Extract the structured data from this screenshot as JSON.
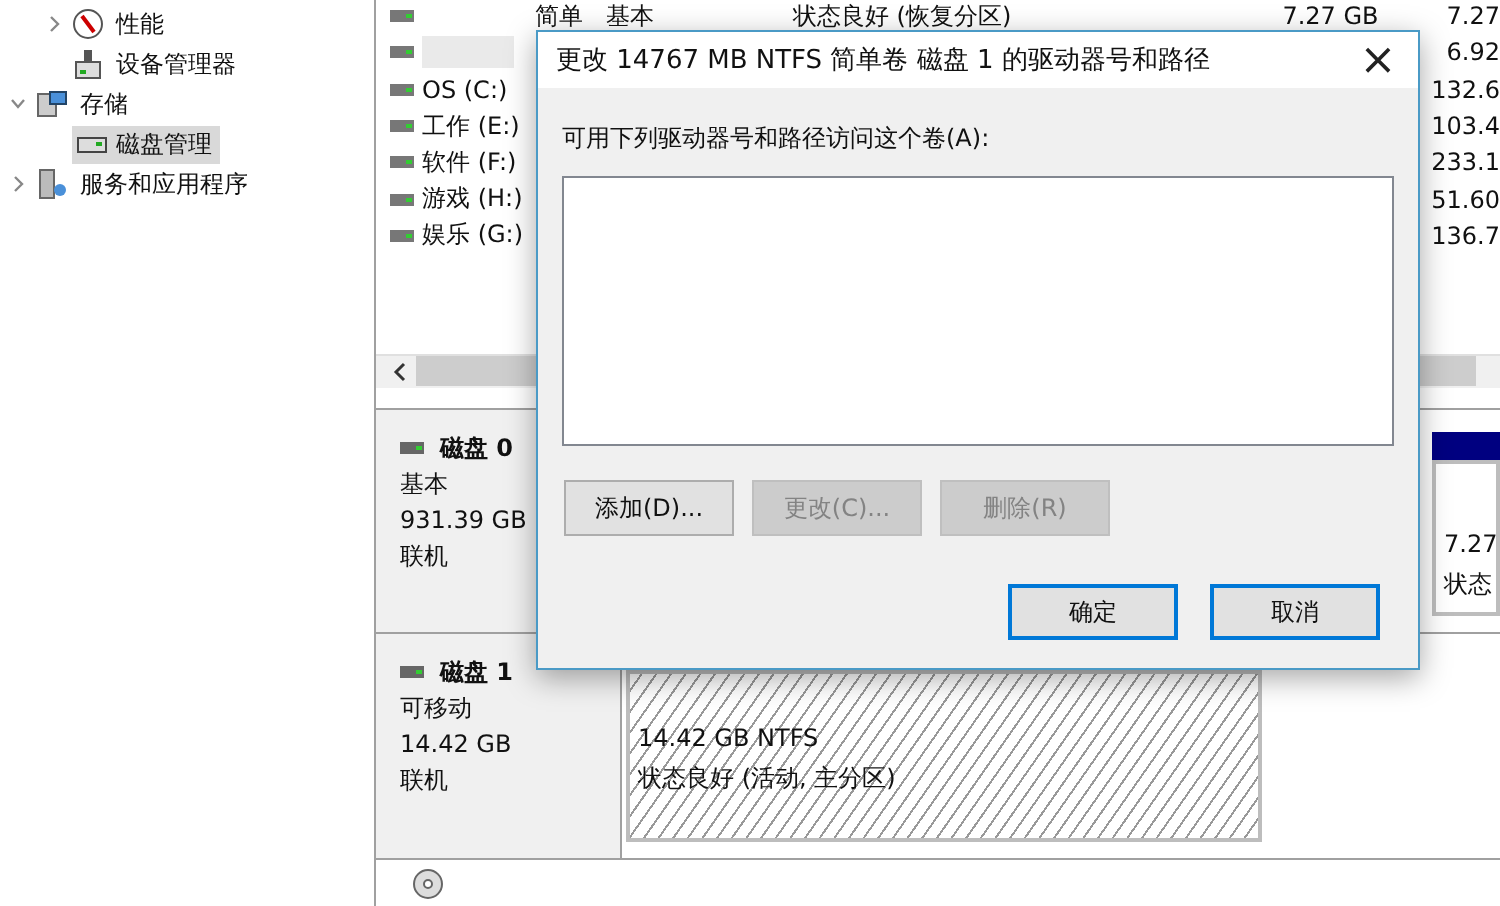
{
  "sidebar": {
    "upper_items": [
      {
        "label": "性能",
        "expanded": false
      },
      {
        "label": "设备管理器"
      }
    ],
    "items": [
      {
        "label": "存储",
        "expanded": true,
        "children": [
          {
            "label": "磁盘管理",
            "selected": true
          }
        ]
      },
      {
        "label": "服务和应用程序",
        "expanded": false
      }
    ]
  },
  "volumes": [
    {
      "layout": "简单",
      "type": "基本",
      "status": "状态良好 (恢复分区)",
      "capacity": "7.27 GB",
      "free": "7.27",
      "selected": false
    },
    {
      "selected": true,
      "free": "6.92"
    },
    {
      "name": "OS (C:)",
      "free": "132.6",
      "selected": false
    },
    {
      "name": "工作 (E:)",
      "free": "103.4",
      "selected": false
    },
    {
      "name": "软件 (F:)",
      "free": "233.1",
      "selected": false
    },
    {
      "name": "游戏 (H:)",
      "free": "51.60",
      "selected": false
    },
    {
      "name": "娱乐 (G:)",
      "free": "136.7",
      "selected": false
    }
  ],
  "disks": [
    {
      "name": "磁盘 0",
      "type": "基本",
      "size": "931.39 GB",
      "state": "联机",
      "partitions": [
        {
          "kind": "edge",
          "size": "7.27",
          "status": "状态"
        }
      ]
    },
    {
      "name": "磁盘 1",
      "type": "可移动",
      "size": "14.42 GB",
      "state": "联机",
      "partitions": [
        {
          "kind": "hatched",
          "size": "14.42 GB NTFS",
          "status": "状态良好 (活动, 主分区)"
        }
      ]
    }
  ],
  "dialog": {
    "title": "更改 14767 MB NTFS 简单卷 磁盘 1 的驱动器号和路径",
    "close": "×",
    "label": "可用下列驱动器号和路径访问这个卷(A):",
    "list_buttons": [
      {
        "label": "添加(D)...",
        "disabled": false
      },
      {
        "label": "更改(C)...",
        "disabled": true
      },
      {
        "label": "删除(R)",
        "disabled": true
      }
    ],
    "buttons": [
      {
        "label": "确定",
        "default": true
      },
      {
        "label": "取消",
        "default": true
      }
    ]
  }
}
